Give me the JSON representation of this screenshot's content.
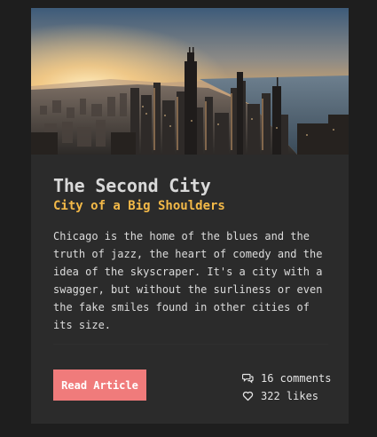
{
  "card": {
    "image_alt": "Chicago skyline at sunset",
    "title": "The Second City",
    "subtitle": "City of a Big Shoulders",
    "body": "Chicago is the home of the blues and the truth of jazz, the heart of comedy and the idea of the skyscraper. It's a city with a swagger, but without the surliness or even the fake smiles found in other cities of its size.",
    "button_label": "Read Article",
    "comments": "16 comments",
    "likes": "322 likes"
  },
  "icons": {
    "comments": "speech-bubbles-icon",
    "likes": "heart-icon"
  },
  "colors": {
    "page_background": "#1e1e1e",
    "card_background": "#2b2b2b",
    "title": "#d9d9d9",
    "subtitle": "#f3b948",
    "button": "#f07b7b",
    "text": "#dcdcdc"
  }
}
